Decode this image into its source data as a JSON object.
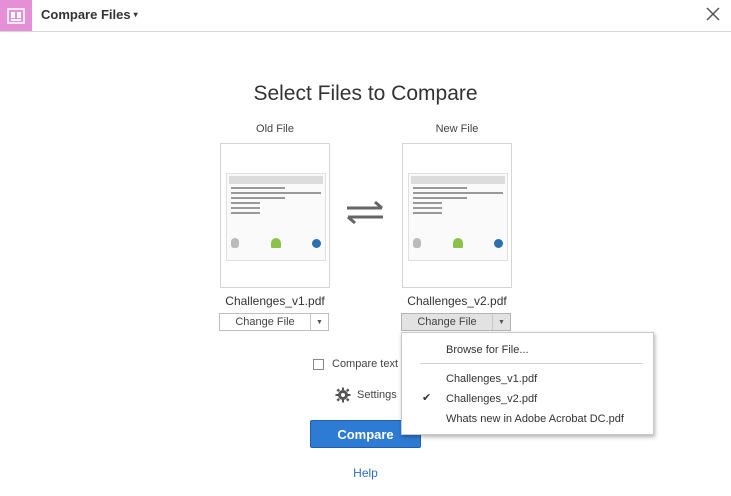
{
  "header": {
    "title": "Compare Files",
    "caret": "▾",
    "close_icon": "close-icon",
    "accent": "#e58fd7"
  },
  "main": {
    "heading": "Select Files to Compare",
    "old_file": {
      "label": "Old File",
      "file_name": "Challenges_v1.pdf",
      "change_label": "Change File",
      "arrow": "▼"
    },
    "new_file": {
      "label": "New File",
      "file_name": "Challenges_v2.pdf",
      "change_label": "Change File",
      "arrow": "▼"
    },
    "compare_text_label": "Compare text o",
    "settings_label": "Settings",
    "compare_button": "Compare",
    "help_link": "Help",
    "compare_color": "#2d7bd3"
  },
  "dropdown": {
    "browse": "Browse for File...",
    "items": [
      "Challenges_v1.pdf",
      "Challenges_v2.pdf",
      "Whats new in Adobe Acrobat DC.pdf"
    ],
    "check": "✔"
  }
}
